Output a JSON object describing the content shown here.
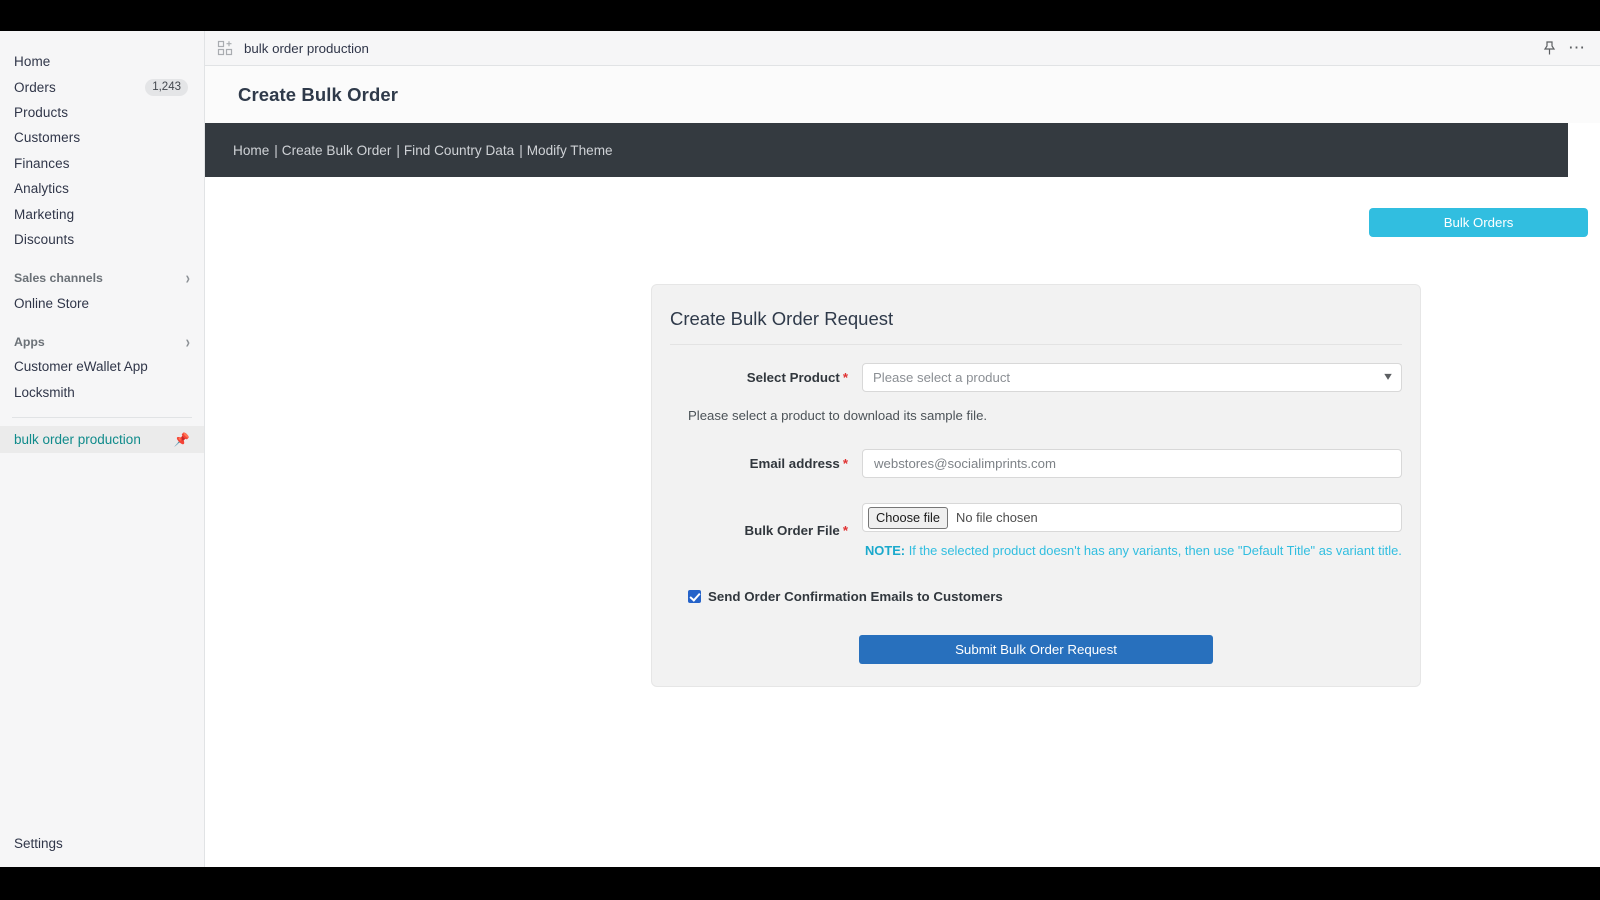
{
  "sidebar": {
    "nav": [
      {
        "label": "Home",
        "badge": ""
      },
      {
        "label": "Orders",
        "badge": "1,243"
      },
      {
        "label": "Products",
        "badge": ""
      },
      {
        "label": "Customers",
        "badge": ""
      },
      {
        "label": "Finances",
        "badge": ""
      },
      {
        "label": "Analytics",
        "badge": ""
      },
      {
        "label": "Marketing",
        "badge": ""
      },
      {
        "label": "Discounts",
        "badge": ""
      }
    ],
    "sales_channels": {
      "label": "Sales channels",
      "chevron": "chevron-right-icon"
    },
    "online_store": "Online Store",
    "apps_section": {
      "label": "Apps",
      "chevron": "chevron-right-icon"
    },
    "apps": [
      "Customer eWallet App",
      "Locksmith"
    ],
    "active_app": {
      "label": "bulk order production",
      "pin": "pin-icon"
    },
    "settings": "Settings",
    "accent_active": "#108b8b"
  },
  "topbar": {
    "app_icon": "apps-add-icon",
    "title": "bulk order production",
    "pin_icon": "pin-icon",
    "more_icon": "ellipsis-icon"
  },
  "page": {
    "title": "Create Bulk Order"
  },
  "darknav": {
    "background": "#343a40",
    "links": [
      "Home",
      "Create Bulk Order",
      "Find Country Data",
      "Modify Theme"
    ],
    "separator": "|"
  },
  "actions": {
    "bulk_orders_label": "Bulk Orders",
    "bulk_orders_color": "#31bee0"
  },
  "form": {
    "card_title": "Create Bulk Order Request",
    "product": {
      "label": "Select Product",
      "required": "*",
      "selected": "Please select a product",
      "chevron": "chevron-down-icon",
      "hint": "Please select a product to download its sample file."
    },
    "email": {
      "label": "Email address",
      "required": "*",
      "value": "webstores@socialimprints.com",
      "placeholder": "Email address"
    },
    "file": {
      "label": "Bulk Order File",
      "required": "*",
      "button": "Choose file",
      "status": "No file chosen",
      "note_prefix": "NOTE:",
      "note_text": " If the selected product doesn't has any variants, then use \"Default Title\" as variant title.",
      "note_color": "#31bee0"
    },
    "confirm": {
      "label": "Send Order Confirmation Emails to Customers",
      "checked": true
    },
    "submit": {
      "label": "Submit Bulk Order Request",
      "color": "#2870bd"
    }
  }
}
